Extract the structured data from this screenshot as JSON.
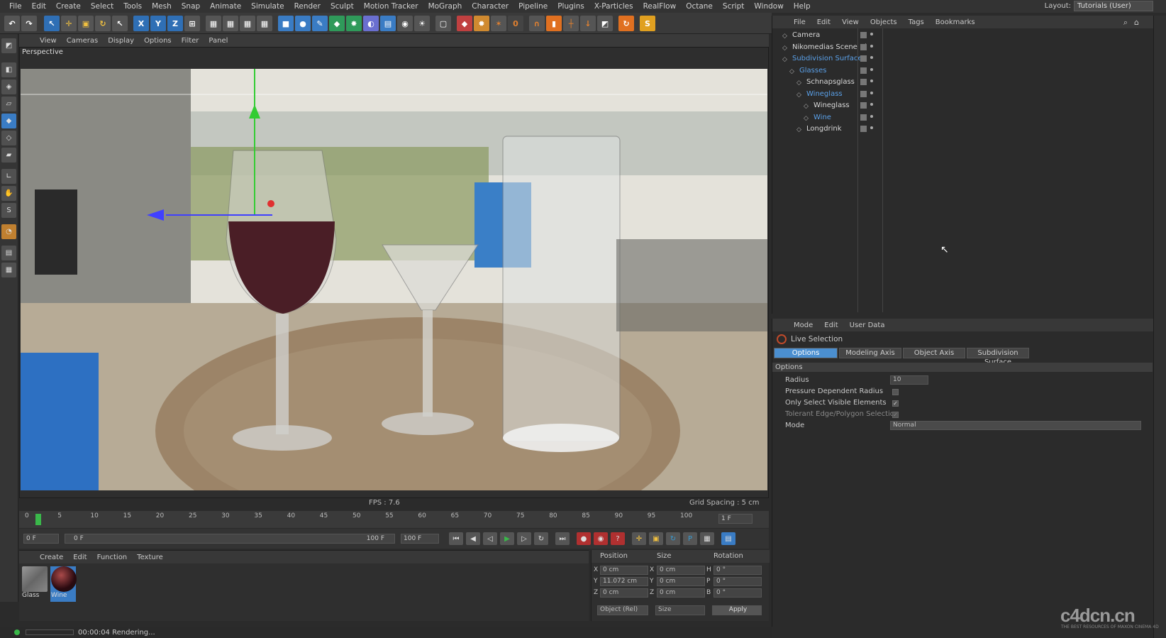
{
  "menu": [
    "File",
    "Edit",
    "Create",
    "Select",
    "Tools",
    "Mesh",
    "Snap",
    "Animate",
    "Simulate",
    "Render",
    "Sculpt",
    "Motion Tracker",
    "MoGraph",
    "Character",
    "Pipeline",
    "Plugins",
    "X-Particles",
    "RealFlow",
    "Octane",
    "Script",
    "Window",
    "Help"
  ],
  "layout": {
    "label": "Layout:",
    "value": "Tutorials (User)"
  },
  "viewport": {
    "menu": [
      "View",
      "Cameras",
      "Display",
      "Options",
      "Filter",
      "Panel"
    ],
    "label": "Perspective",
    "fps": "FPS : 7.6",
    "grid": "Grid Spacing : 5 cm"
  },
  "timeline": {
    "ticks": [
      "0",
      "5",
      "10",
      "15",
      "20",
      "25",
      "30",
      "35",
      "40",
      "45",
      "50",
      "55",
      "60",
      "65",
      "70",
      "75",
      "80",
      "85",
      "90",
      "95",
      "100"
    ],
    "end_field": "1 F",
    "start_field": "0 F",
    "range_start": "0 F",
    "range_end": "100 F",
    "max_field": "100 F"
  },
  "materials": {
    "menu": [
      "Create",
      "Edit",
      "Function",
      "Texture"
    ],
    "items": [
      {
        "name": "Glass"
      },
      {
        "name": "Wine"
      }
    ]
  },
  "coords": {
    "headers": [
      "Position",
      "Size",
      "Rotation"
    ],
    "rows": [
      {
        "a": "X",
        "pos": "0 cm",
        "b": "X",
        "size": "0 cm",
        "c": "H",
        "rot": "0 °"
      },
      {
        "a": "Y",
        "pos": "11.072 cm",
        "b": "Y",
        "size": "0 cm",
        "c": "P",
        "rot": "0 °"
      },
      {
        "a": "Z",
        "pos": "0 cm",
        "b": "Z",
        "size": "0 cm",
        "c": "B",
        "rot": "0 °"
      }
    ],
    "mode": "Object (Rel)",
    "size_mode": "Size",
    "apply": "Apply"
  },
  "status": "00:00:04 Rendering...",
  "objects": {
    "menu": [
      "File",
      "Edit",
      "View",
      "Objects",
      "Tags",
      "Bookmarks"
    ],
    "rows": [
      {
        "name": "Camera",
        "indent": 0,
        "color": "#d8d8d8"
      },
      {
        "name": "Nikomedias Scene Ri",
        "indent": 0,
        "color": "#d8d8d8"
      },
      {
        "name": "Subdivision Surface",
        "indent": 0,
        "color": "#5aa0e8"
      },
      {
        "name": "Glasses",
        "indent": 1,
        "color": "#5aa0e8"
      },
      {
        "name": "Schnapsglass",
        "indent": 2,
        "color": "#d8d8d8"
      },
      {
        "name": "Wineglass",
        "indent": 2,
        "color": "#5aa0e8"
      },
      {
        "name": "Wineglass",
        "indent": 3,
        "color": "#d8d8d8"
      },
      {
        "name": "Wine",
        "indent": 3,
        "color": "#5aa0e8"
      },
      {
        "name": "Longdrink",
        "indent": 2,
        "color": "#d8d8d8"
      }
    ]
  },
  "attributes": {
    "menu": [
      "Mode",
      "Edit",
      "User Data"
    ],
    "tool": "Live Selection",
    "tabs": [
      "Options",
      "Modeling Axis",
      "Object Axis",
      "Subdivision Surface"
    ],
    "section": "Options",
    "radius_label": "Radius",
    "radius_value": "10",
    "pressure_label": "Pressure Dependent Radius",
    "visible_label": "Only Select Visible Elements",
    "tolerant_label": "Tolerant Edge/Polygon Selection",
    "mode_label": "Mode",
    "mode_value": "Normal"
  },
  "watermark": {
    "text": "c4dcn.cn",
    "sub": "THE BEST RESOURCES OF MAXON CINEMA 4D"
  },
  "colors": {
    "accent": "#4b8fd0",
    "bg": "#2b2b2b"
  }
}
